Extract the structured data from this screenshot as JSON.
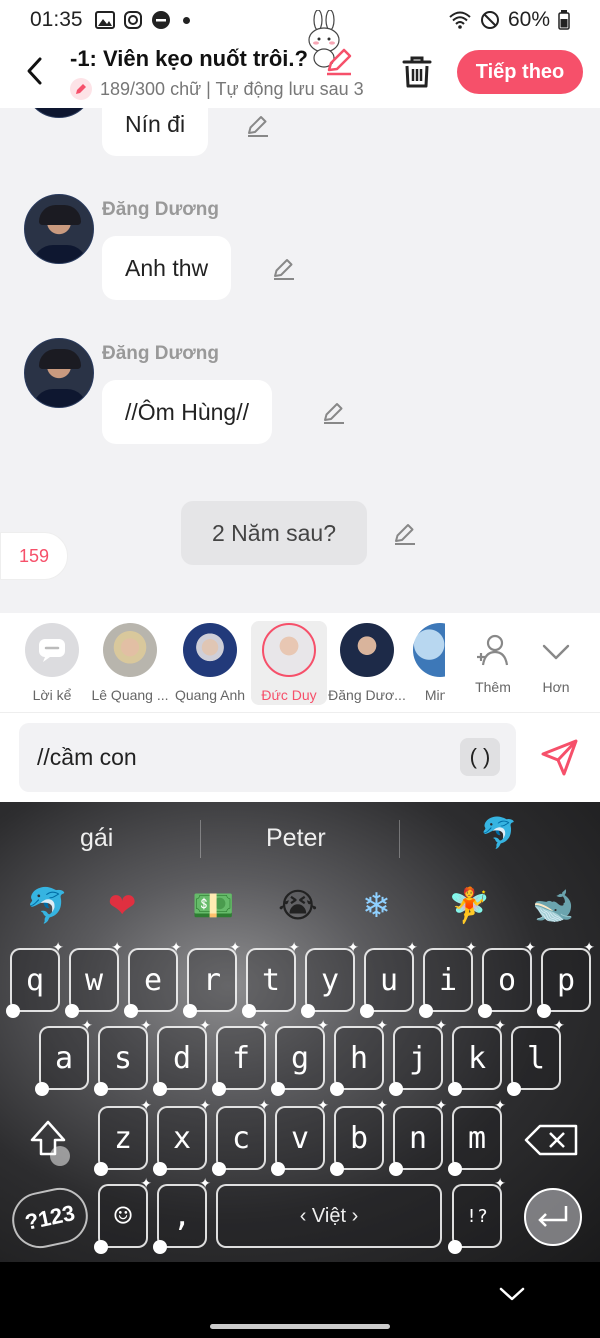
{
  "status_bar": {
    "time": "01:35",
    "battery": "60%"
  },
  "header": {
    "title": "-1: Viên kẹo nuốt trôi.?",
    "subtitle": "189/300 chữ | Tự động lưu sau 3",
    "next_label": "Tiếp theo"
  },
  "chat": {
    "messages": [
      {
        "sender": "",
        "text": "Nín đi"
      },
      {
        "sender": "Đăng Dương",
        "text": "Anh thw"
      },
      {
        "sender": "Đăng Dương",
        "text": "//Ôm Hùng//"
      }
    ],
    "narration": "2 Năm sau?",
    "count": "159"
  },
  "characters": [
    {
      "label": "Lời kể"
    },
    {
      "label": "Lê Quang ..."
    },
    {
      "label": "Quang Anh"
    },
    {
      "label": "Đức Duy"
    },
    {
      "label": "Đăng Dươ..."
    },
    {
      "label": "Minh"
    },
    {
      "label": "Thêm"
    },
    {
      "label": "Hơn"
    }
  ],
  "input": {
    "value": "//cầm con",
    "paren_label": "( )"
  },
  "keyboard": {
    "suggestions": [
      "gái",
      "Peter"
    ],
    "emojis": [
      "🐬",
      "❤",
      "💵",
      "😭",
      "❄",
      "🧚",
      "🐋"
    ],
    "row1": [
      "q",
      "w",
      "e",
      "r",
      "t",
      "y",
      "u",
      "i",
      "o",
      "p"
    ],
    "row2": [
      "a",
      "s",
      "d",
      "f",
      "g",
      "h",
      "j",
      "k",
      "l"
    ],
    "row3": [
      "z",
      "x",
      "c",
      "v",
      "b",
      "n",
      "m"
    ],
    "symbols_label": "?123",
    "emoji_key": "☺",
    "comma": ",",
    "space_label": "‹ Việt ›",
    "punct_label": "!?"
  },
  "colors": {
    "accent": "#f6506a"
  }
}
